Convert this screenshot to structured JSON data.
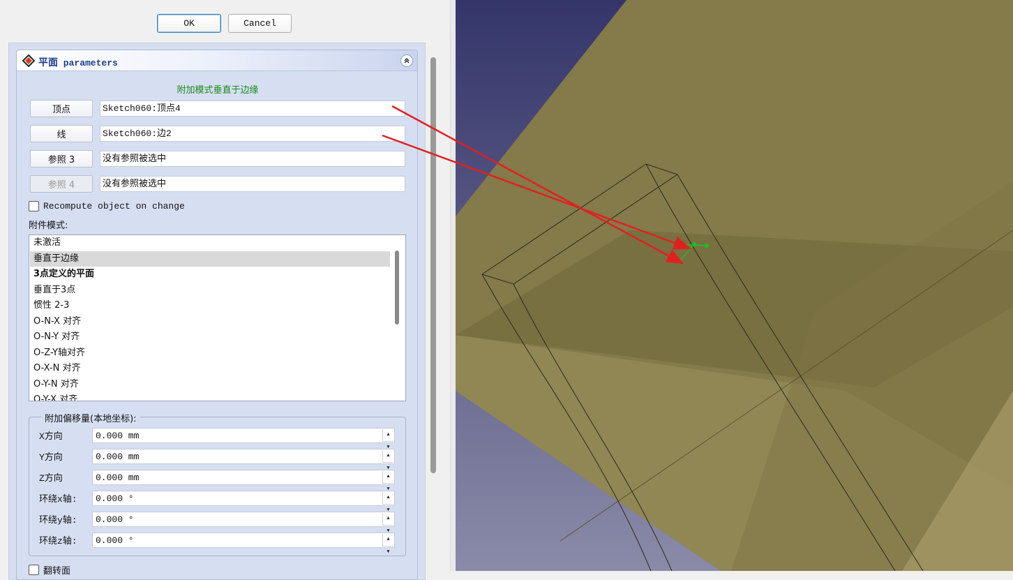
{
  "dialog": {
    "ok_label": "OK",
    "cancel_label": "Cancel"
  },
  "panel": {
    "title_cn": "平面",
    "title_en": " parameters",
    "mode_title": "附加模式垂直于边缘",
    "references": [
      {
        "button": "顶点",
        "value": "Sketch060:顶点4",
        "enabled": true
      },
      {
        "button": "线",
        "value": "Sketch060:边2",
        "enabled": true
      },
      {
        "button": "参照 3",
        "value": "没有参照被选中",
        "enabled": true
      },
      {
        "button": "参照 4",
        "value": "没有参照被选中",
        "enabled": false
      }
    ],
    "recompute_label": "Recompute object on change",
    "attach_mode_label": "附件模式:",
    "modes": [
      "未激活",
      "垂直于边缘",
      "3点定义的平面",
      "垂直于3点",
      "惯性 2-3",
      "O-N-X 对齐",
      "O-N-Y 对齐",
      "O-Z-Y轴对齐",
      "O-X-N 对齐",
      "O-Y-N 对齐",
      "O-Y-X 对齐"
    ],
    "selected_mode": "垂直于边缘",
    "bold_mode": "3点定义的平面",
    "offset_group_label": "附加偏移量(本地坐标):",
    "offsets": [
      {
        "label": "X方向",
        "value": "0.000 mm"
      },
      {
        "label": "Y方向",
        "value": "0.000 mm"
      },
      {
        "label": "Z方向",
        "value": "0.000 mm"
      },
      {
        "label": "环绕x轴:",
        "value": "0.000 °"
      },
      {
        "label": "环绕y轴:",
        "value": "0.000 °"
      },
      {
        "label": "环绕z轴:",
        "value": "0.000 °"
      }
    ],
    "flip_label": "翻转面"
  },
  "colors": {
    "panel_bg": "#d6dff2",
    "mode_title": "#1a8a1a",
    "header_title": "#1d3e8c",
    "viewport_blue": "#3a3a6a",
    "plane_olive": "#8c7f4a",
    "arrow_red": "#e02020",
    "sketch_green": "#22bb22"
  },
  "icons": {
    "panel_icon": "datum-plane-icon",
    "collapse": "collapse-up-icon",
    "spin": "spin-arrows-icon"
  }
}
